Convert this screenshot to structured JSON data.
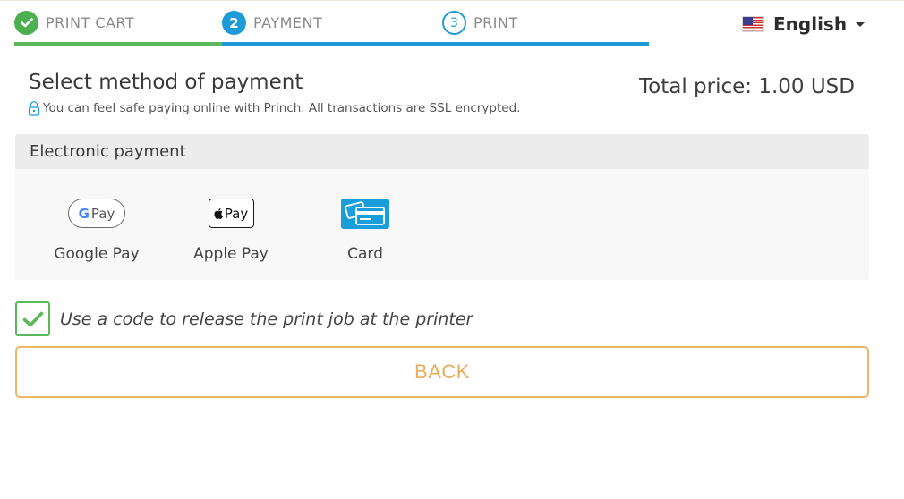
{
  "steps": [
    {
      "number": "",
      "label": "PRINT CART",
      "state": "done"
    },
    {
      "number": "2",
      "label": "PAYMENT",
      "state": "active"
    },
    {
      "number": "3",
      "label": "PRINT",
      "state": "upcoming"
    }
  ],
  "language": {
    "label": "English",
    "flag_icon": "us-flag-icon"
  },
  "heading": "Select method of payment",
  "security_note": "You can feel safe paying online with Princh. All transactions are SSL encrypted.",
  "total_price": "Total price: 1.00 USD",
  "panel": {
    "title": "Electronic payment",
    "methods": [
      {
        "label": "Google Pay",
        "icon": "google-pay-icon",
        "badge_text": "Pay"
      },
      {
        "label": "Apple Pay",
        "icon": "apple-pay-icon",
        "badge_text": "Pay"
      },
      {
        "label": "Card",
        "icon": "credit-card-icon"
      }
    ]
  },
  "release_code": {
    "label": "Use a code to release the print job at the printer",
    "checked": true
  },
  "back_button": "BACK",
  "colors": {
    "done": "#5cb85c",
    "active": "#1e9bd7",
    "back_button": "#e8ad5a"
  }
}
